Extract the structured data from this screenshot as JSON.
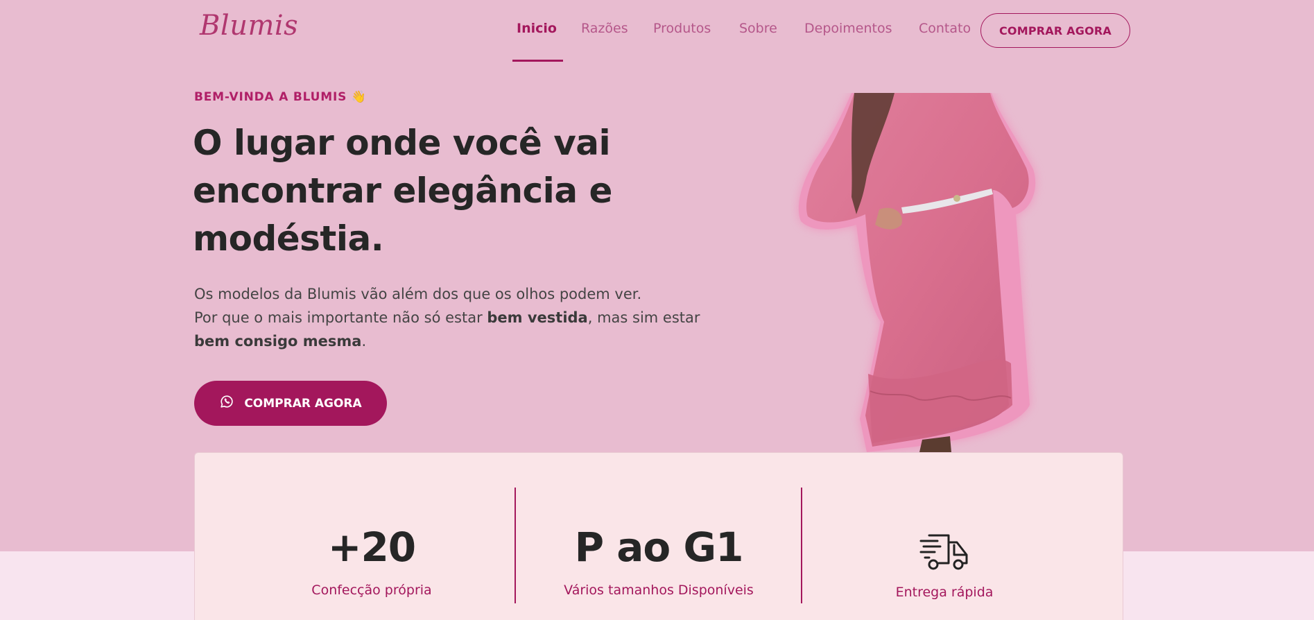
{
  "header": {
    "logo": "Blumis",
    "nav": [
      {
        "label": "Inicio",
        "active": true
      },
      {
        "label": "Razões",
        "active": false
      },
      {
        "label": "Produtos",
        "active": false
      },
      {
        "label": "Sobre",
        "active": false
      },
      {
        "label": "Depoimentos",
        "active": false
      },
      {
        "label": "Contato",
        "active": false
      }
    ],
    "cta_label": "COMPRAR AGORA"
  },
  "hero": {
    "eyebrow": "BEM-VINDA A BLUMIS 👋",
    "headline": "O lugar onde você vai encontrar elegância e modéstia.",
    "intro": {
      "line1": "Os modelos da Blumis vão além dos que os olhos podem ver.",
      "line2_pre": "Por que o mais importante não só estar ",
      "line2_bold": "bem vestida",
      "line2_post": ", mas sim estar",
      "line3_bold": "bem consigo mesma",
      "line3_post": "."
    },
    "cta_label": "COMPRAR AGORA",
    "cta_icon": "whatsapp-icon"
  },
  "stats": [
    {
      "value": "+20",
      "label": "Confecção própria"
    },
    {
      "value": "P ao G1",
      "label": "Vários tamanhos Disponíveis"
    },
    {
      "icon": "delivery-truck-icon",
      "label": "Entrega rápida"
    }
  ],
  "colors": {
    "background": "#e8bcd0",
    "accent": "#a3175c",
    "card": "#fae5e8",
    "dress": "#d9718f"
  }
}
